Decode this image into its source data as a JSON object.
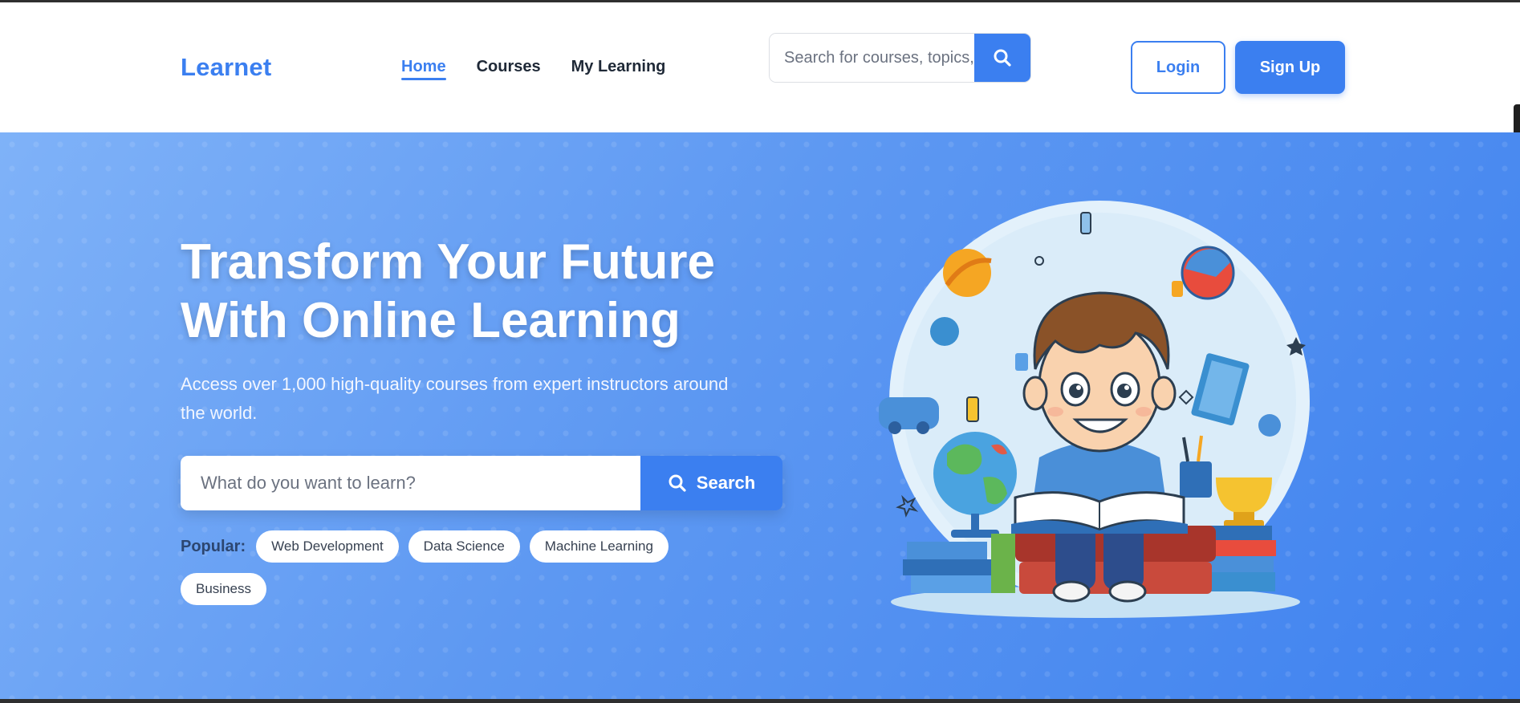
{
  "header": {
    "logo": "Learnet",
    "nav": [
      {
        "label": "Home",
        "active": true
      },
      {
        "label": "Courses",
        "active": false
      },
      {
        "label": "My Learning",
        "active": false
      }
    ],
    "search": {
      "placeholder": "Search for courses, topics, instructors",
      "button_icon": "search-icon"
    },
    "login_label": "Login",
    "signup_label": "Sign Up"
  },
  "hero": {
    "title_line1": "Transform Your Future",
    "title_line2": "With Online Learning",
    "subtitle": "Access over 1,000 high-quality courses from expert instructors around the world.",
    "search": {
      "placeholder": "What do you want to learn?",
      "button_label": "Search",
      "button_icon": "search-icon"
    },
    "popular_label": "Popular:",
    "popular_tags": [
      "Web Development",
      "Data Science",
      "Machine Learning",
      "Business"
    ],
    "illustration": "boy-reading-book-illustration"
  },
  "colors": {
    "brand": "#3b7ff0",
    "hero_gradient_start": "#7fb2f8",
    "hero_gradient_end": "#3f82ef",
    "text_dark": "#1f2937"
  }
}
